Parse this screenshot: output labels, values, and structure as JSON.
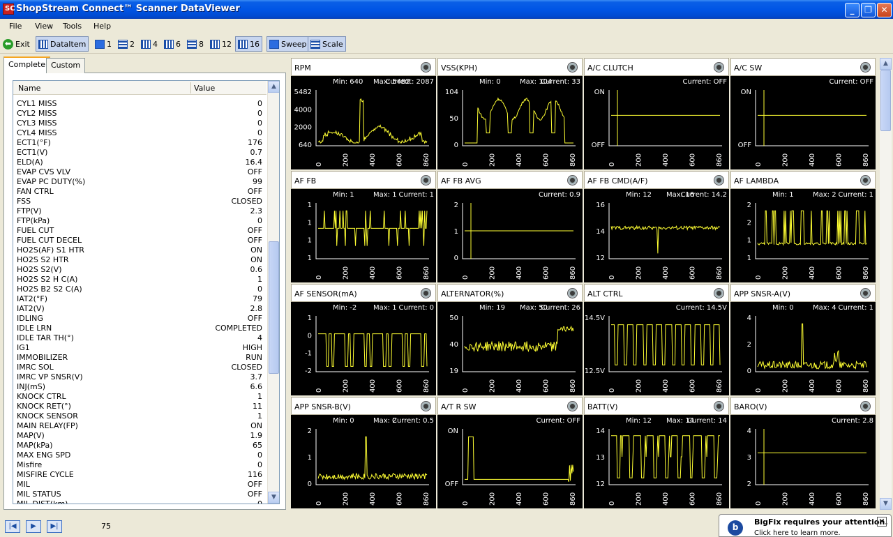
{
  "window": {
    "title": "ShopStream Connect™ Scanner DataViewer",
    "min": "_",
    "max": "❐",
    "close": "✕",
    "app_icon": "SC"
  },
  "menu": [
    "File",
    "View",
    "Tools",
    "Help"
  ],
  "toolbar": {
    "exit": "Exit",
    "dataitem": "DataItem",
    "layouts": [
      "1",
      "2",
      "4",
      "6",
      "8",
      "12",
      "16"
    ],
    "sweep": "Sweep",
    "scale": "Scale",
    "selected_layout": "16"
  },
  "tabs": {
    "complete": "Complete",
    "custom": "Custom"
  },
  "grid": {
    "col_name": "Name",
    "col_value": "Value",
    "rows": [
      {
        "n": "CYL1 MISS",
        "v": "0"
      },
      {
        "n": "CYL2 MISS",
        "v": "0"
      },
      {
        "n": "CYL3 MISS",
        "v": "0"
      },
      {
        "n": "CYL4 MISS",
        "v": "0"
      },
      {
        "n": "ECT1(°F)",
        "v": "176"
      },
      {
        "n": "ECT1(V)",
        "v": "0.7"
      },
      {
        "n": "ELD(A)",
        "v": "16.4"
      },
      {
        "n": "EVAP CVS VLV",
        "v": "OFF"
      },
      {
        "n": "EVAP PC DUTY(%)",
        "v": "99"
      },
      {
        "n": "FAN CTRL",
        "v": "OFF"
      },
      {
        "n": "FSS",
        "v": "CLOSED"
      },
      {
        "n": "FTP(V)",
        "v": "2.3"
      },
      {
        "n": "FTP(kPa)",
        "v": "0"
      },
      {
        "n": "FUEL CUT",
        "v": "OFF"
      },
      {
        "n": "FUEL CUT DECEL",
        "v": "OFF"
      },
      {
        "n": "HO2S(AF) S1 HTR",
        "v": "ON"
      },
      {
        "n": "HO2S S2 HTR",
        "v": "ON"
      },
      {
        "n": "HO2S S2(V)",
        "v": "0.6"
      },
      {
        "n": "HO2S S2 H C(A)",
        "v": "1"
      },
      {
        "n": "HO2S B2 S2 C(A)",
        "v": "0"
      },
      {
        "n": "IAT2(°F)",
        "v": "79"
      },
      {
        "n": "IAT2(V)",
        "v": "2.8"
      },
      {
        "n": "IDLING",
        "v": "OFF"
      },
      {
        "n": "IDLE LRN",
        "v": "COMPLETED"
      },
      {
        "n": "IDLE TAR TH(°)",
        "v": "4"
      },
      {
        "n": "IG1",
        "v": "HIGH"
      },
      {
        "n": "IMMOBILIZER",
        "v": "RUN"
      },
      {
        "n": "IMRC SOL",
        "v": "CLOSED"
      },
      {
        "n": "IMRC VP SNSR(V)",
        "v": "3.7"
      },
      {
        "n": "INJ(mS)",
        "v": "6.6"
      },
      {
        "n": "KNOCK CTRL",
        "v": "1"
      },
      {
        "n": "KNOCK RET(°)",
        "v": "11"
      },
      {
        "n": "KNOCK SENSOR",
        "v": "1"
      },
      {
        "n": "MAIN RELAY(FP)",
        "v": "ON"
      },
      {
        "n": "MAP(V)",
        "v": "1.9"
      },
      {
        "n": "MAP(kPa)",
        "v": "65"
      },
      {
        "n": "MAX ENG SPD",
        "v": "0"
      },
      {
        "n": "Misfire",
        "v": "0"
      },
      {
        "n": "MISFIRE CYCLE",
        "v": "116"
      },
      {
        "n": "MIL",
        "v": "OFF"
      },
      {
        "n": "MIL STATUS",
        "v": "OFF"
      },
      {
        "n": "MIL DIST(km)",
        "v": "0"
      }
    ]
  },
  "status": {
    "value": "75"
  },
  "notification": {
    "title": "BigFix requires your attention.",
    "subtitle": "Click here to learn more.",
    "icon": "b",
    "close": "✕"
  },
  "trace_color": "#ffff33",
  "chart_data": [
    {
      "type": "line",
      "title": "RPM",
      "stats": {
        "min": "Min: 640",
        "max": "Max: 5482",
        "current": "Current: 2087"
      },
      "y_ticks": [
        "5482",
        "4000",
        "2000",
        "640"
      ],
      "ylim": [
        640,
        5482
      ],
      "xlim": [
        0,
        860
      ],
      "x_ticks": [
        "0",
        "200",
        "400",
        "600",
        "860"
      ],
      "pattern": "rpm"
    },
    {
      "type": "line",
      "title": "VSS(KPH)",
      "stats": {
        "min": "Min: 0",
        "max": "Max: 104",
        "current": "Current: 33"
      },
      "y_ticks": [
        "104",
        "50",
        "0"
      ],
      "ylim": [
        0,
        104
      ],
      "xlim": [
        0,
        860
      ],
      "x_ticks": [
        "0",
        "200",
        "400",
        "600",
        "860"
      ],
      "pattern": "vss"
    },
    {
      "type": "line",
      "title": "A/C CLUTCH",
      "stats": {
        "min": "",
        "max": "",
        "current": "Current: OFF"
      },
      "y_ticks": [
        "ON",
        "OFF"
      ],
      "ylim": [
        0,
        1
      ],
      "xlim": [
        0,
        860
      ],
      "x_ticks": [
        "0",
        "200",
        "400",
        "600",
        "860"
      ],
      "pattern": "flatspike"
    },
    {
      "type": "line",
      "title": "A/C SW",
      "stats": {
        "min": "",
        "max": "",
        "current": "Current: OFF"
      },
      "y_ticks": [
        "ON",
        "OFF"
      ],
      "ylim": [
        0,
        1
      ],
      "xlim": [
        0,
        860
      ],
      "x_ticks": [
        "0",
        "200",
        "400",
        "600",
        "860"
      ],
      "pattern": "flatspike"
    },
    {
      "type": "line",
      "title": "AF FB",
      "stats": {
        "min": "Min: 1",
        "max": "Max: 1",
        "current": "Current: 1"
      },
      "y_ticks": [
        "1",
        "1",
        "1",
        "1"
      ],
      "ylim": [
        0,
        1
      ],
      "xlim": [
        0,
        860
      ],
      "x_ticks": [
        "0",
        "200",
        "400",
        "600",
        "860"
      ],
      "pattern": "affb"
    },
    {
      "type": "line",
      "title": "AF FB AVG",
      "stats": {
        "min": "",
        "max": "",
        "current": "Current: 0.9"
      },
      "y_ticks": [
        "2",
        "1",
        "0"
      ],
      "ylim": [
        0,
        2
      ],
      "xlim": [
        0,
        860
      ],
      "x_ticks": [
        "0",
        "200",
        "400",
        "600",
        "860"
      ],
      "pattern": "flatmid"
    },
    {
      "type": "line",
      "title": "AF FB CMD(A/F)",
      "stats": {
        "min": "Min: 12",
        "max": "Max: 16",
        "current": "Current: 14.2"
      },
      "y_ticks": [
        "16",
        "14",
        "12"
      ],
      "ylim": [
        12,
        16
      ],
      "xlim": [
        0,
        860
      ],
      "x_ticks": [
        "0",
        "200",
        "400",
        "600",
        "860"
      ],
      "pattern": "afcmd"
    },
    {
      "type": "line",
      "title": "AF LAMBDA",
      "stats": {
        "min": "Min: 1",
        "max": "Max: 2",
        "current": "Current: 1"
      },
      "y_ticks": [
        "2",
        "2",
        "1",
        "1"
      ],
      "ylim": [
        0,
        1
      ],
      "xlim": [
        0,
        860
      ],
      "x_ticks": [
        "0",
        "200",
        "400",
        "600",
        "860"
      ],
      "pattern": "lambda"
    },
    {
      "type": "line",
      "title": "AF SENSOR(mA)",
      "stats": {
        "min": "Min: -2",
        "max": "Max: 1",
        "current": "Current: 0"
      },
      "y_ticks": [
        "1",
        "0",
        "-1",
        "-2"
      ],
      "ylim": [
        -2,
        1
      ],
      "xlim": [
        0,
        860
      ],
      "x_ticks": [
        "0",
        "200",
        "400",
        "600",
        "860"
      ],
      "pattern": "afsensor"
    },
    {
      "type": "line",
      "title": "ALTERNATOR(%)",
      "stats": {
        "min": "Min: 19",
        "max": "Max: 50",
        "current": "Current: 26"
      },
      "y_ticks": [
        "50",
        "40",
        "19"
      ],
      "ylim": [
        19,
        50
      ],
      "xlim": [
        0,
        860
      ],
      "x_ticks": [
        "0",
        "200",
        "400",
        "600",
        "860"
      ],
      "pattern": "alt"
    },
    {
      "type": "line",
      "title": "ALT CTRL",
      "stats": {
        "min": "",
        "max": "",
        "current": "Current: 14.5V"
      },
      "y_ticks": [
        "14.5V",
        "12.5V"
      ],
      "ylim": [
        0,
        1
      ],
      "xlim": [
        0,
        860
      ],
      "x_ticks": [
        "0",
        "200",
        "400",
        "600",
        "860"
      ],
      "pattern": "altctrl"
    },
    {
      "type": "line",
      "title": "APP SNSR-A(V)",
      "stats": {
        "min": "Min: 0",
        "max": "Max: 4",
        "current": "Current: 1"
      },
      "y_ticks": [
        "4",
        "2",
        "0"
      ],
      "ylim": [
        0,
        4
      ],
      "xlim": [
        0,
        860
      ],
      "x_ticks": [
        "0",
        "200",
        "400",
        "600",
        "860"
      ],
      "pattern": "appa"
    },
    {
      "type": "line",
      "title": "APP SNSR-B(V)",
      "stats": {
        "min": "Min: 0",
        "max": "Max: 2",
        "current": "Current: 0.5"
      },
      "y_ticks": [
        "2",
        "1",
        "0"
      ],
      "ylim": [
        0,
        2
      ],
      "xlim": [
        0,
        860
      ],
      "x_ticks": [
        "0",
        "200",
        "400",
        "600",
        "860"
      ],
      "pattern": "appb"
    },
    {
      "type": "line",
      "title": "A/T R SW",
      "stats": {
        "min": "",
        "max": "",
        "current": "Current: OFF"
      },
      "y_ticks": [
        "ON",
        "OFF"
      ],
      "ylim": [
        0,
        1
      ],
      "xlim": [
        0,
        860
      ],
      "x_ticks": [
        "0",
        "200",
        "400",
        "600",
        "860"
      ],
      "pattern": "atr"
    },
    {
      "type": "line",
      "title": "BATT(V)",
      "stats": {
        "min": "Min: 12",
        "max": "Max: 14",
        "current": "Current: 14"
      },
      "y_ticks": [
        "14",
        "13",
        "12"
      ],
      "ylim": [
        12,
        14
      ],
      "xlim": [
        0,
        860
      ],
      "x_ticks": [
        "0",
        "200",
        "400",
        "600",
        "860"
      ],
      "pattern": "batt"
    },
    {
      "type": "line",
      "title": "BARO(V)",
      "stats": {
        "min": "",
        "max": "",
        "current": "Current: 2.8"
      },
      "y_ticks": [
        "4",
        "3",
        "2"
      ],
      "ylim": [
        2,
        4
      ],
      "xlim": [
        0,
        860
      ],
      "x_ticks": [
        "0",
        "200",
        "400",
        "600",
        "860"
      ],
      "pattern": "baro"
    }
  ]
}
